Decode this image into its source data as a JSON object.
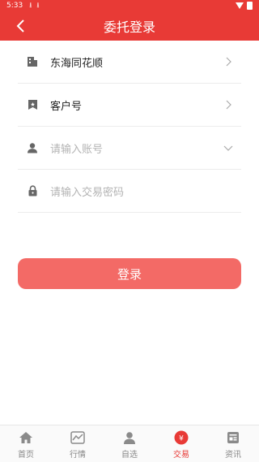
{
  "status_bar": {
    "time": "5:33"
  },
  "header": {
    "title": "委托登录"
  },
  "form": {
    "broker": {
      "label": "东海同花顺"
    },
    "account_type": {
      "label": "客户号"
    },
    "account": {
      "placeholder": "请输入账号"
    },
    "password": {
      "placeholder": "请输入交易密码"
    }
  },
  "login_button": {
    "label": "登录"
  },
  "bottom_nav": {
    "items": [
      {
        "label": "首页",
        "icon": "home-icon"
      },
      {
        "label": "行情",
        "icon": "chart-icon"
      },
      {
        "label": "自选",
        "icon": "person-icon"
      },
      {
        "label": "交易",
        "icon": "yen-icon",
        "active": true
      },
      {
        "label": "资讯",
        "icon": "news-icon"
      }
    ]
  },
  "colors": {
    "primary": "#e83a36",
    "button": "#f36a66"
  }
}
